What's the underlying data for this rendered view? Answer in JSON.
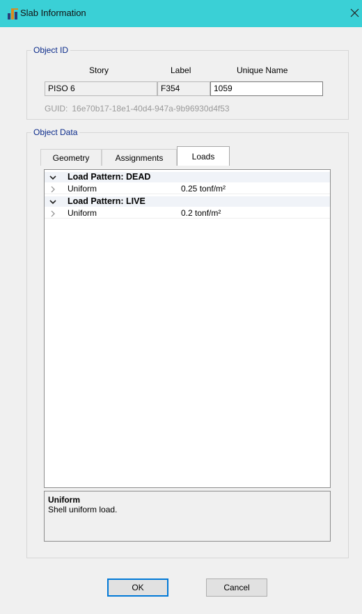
{
  "window": {
    "title": "Slab Information"
  },
  "object_id": {
    "group_title": "Object ID",
    "columns": {
      "story": "Story",
      "label": "Label",
      "unique_name": "Unique Name"
    },
    "values": {
      "story": "PISO 6",
      "label": "F354",
      "unique_name": "1059"
    },
    "guid_label": "GUID:",
    "guid_value": "16e70b17-18e1-40d4-947a-9b96930d4f53"
  },
  "object_data": {
    "group_title": "Object Data",
    "tabs": [
      {
        "label": "Geometry",
        "active": false
      },
      {
        "label": "Assignments",
        "active": false
      },
      {
        "label": "Loads",
        "active": true
      }
    ],
    "tree": [
      {
        "type": "header",
        "label": "Load Pattern: DEAD"
      },
      {
        "type": "item",
        "label": "Uniform",
        "value": "0.25 tonf/m²"
      },
      {
        "type": "header",
        "label": "Load Pattern: LIVE"
      },
      {
        "type": "item",
        "label": "Uniform",
        "value": "0.2 tonf/m²"
      }
    ],
    "description": {
      "title": "Uniform",
      "text": "Shell uniform load."
    }
  },
  "buttons": {
    "ok": "OK",
    "cancel": "Cancel"
  },
  "colors": {
    "titlebar": "#3ad0d6",
    "group_title": "#0a2a8a",
    "default_button_border": "#0078d7"
  },
  "icons": {
    "app": "etabs-app-icon",
    "close": "close-icon",
    "expanded": "chevron-down-icon",
    "collapsed": "chevron-right-icon"
  }
}
